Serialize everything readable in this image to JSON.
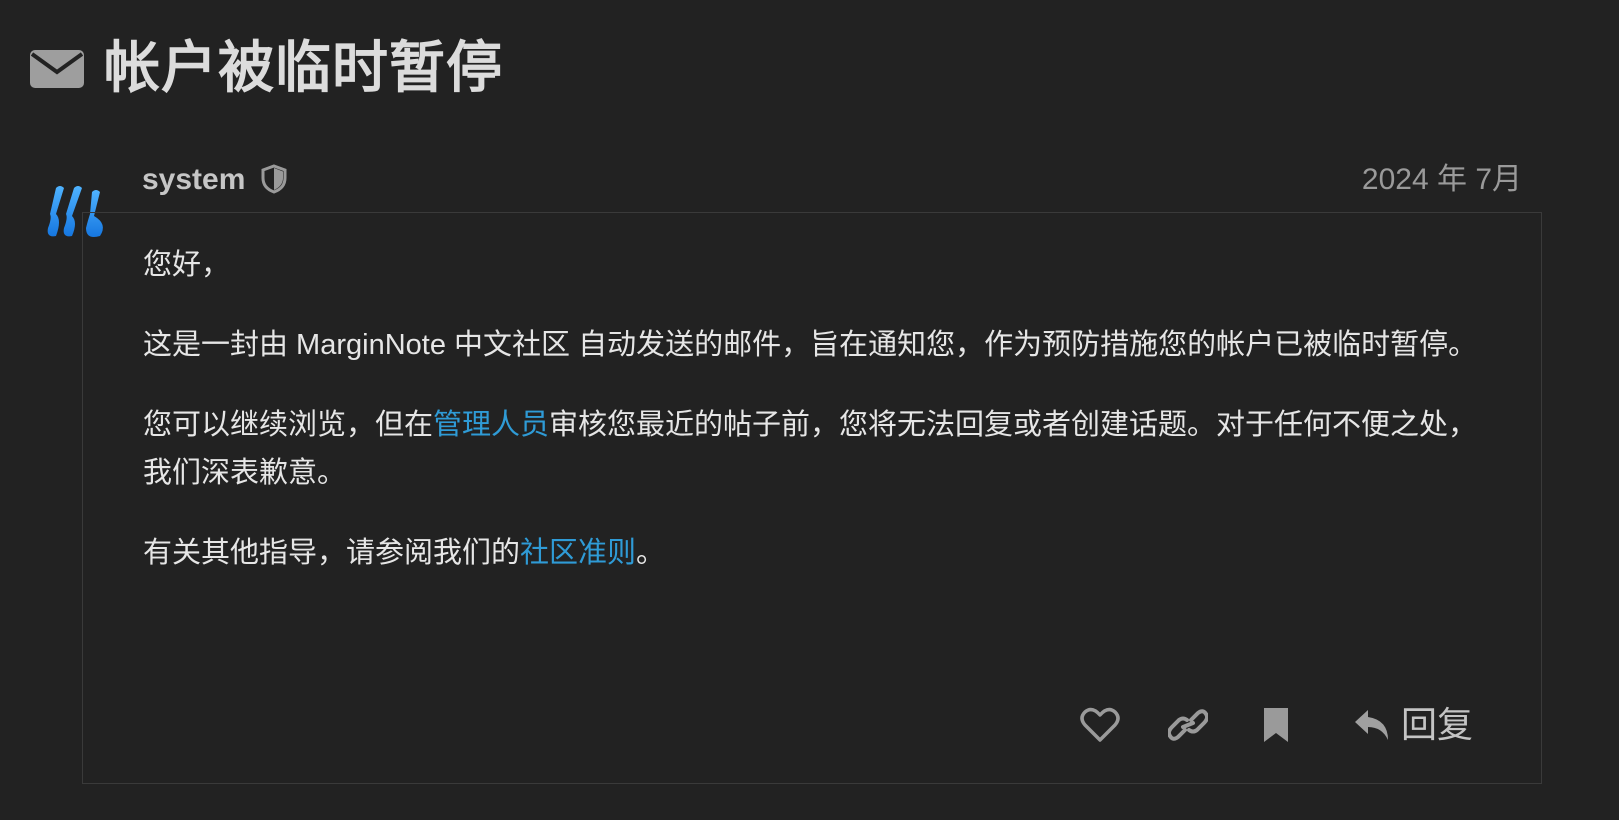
{
  "topic": {
    "title": "帐户被临时暂停",
    "icon": "envelope-icon"
  },
  "post": {
    "author": "system",
    "author_badge_icon": "shield-icon",
    "date": "2024 年 7月",
    "avatar_icon": "marginnote-logo",
    "paragraphs": {
      "p1": "您好，",
      "p2": "这是一封由 MarginNote 中文社区 自动发送的邮件，旨在通知您，作为预防措施您的帐户已被临时暂停。",
      "p3_before": "您可以继续浏览，但在",
      "p3_link": "管理人员",
      "p3_after": "审核您最近的帖子前，您将无法回复或者创建话题。对于任何不便之处，我们深表歉意。",
      "p4_before": "有关其他指导，请参阅我们的",
      "p4_link": "社区准则",
      "p4_after": "。"
    }
  },
  "controls": {
    "like_icon": "heart-icon",
    "share_icon": "link-icon",
    "bookmark_icon": "bookmark-icon",
    "reply_icon": "reply-icon",
    "reply_label": "回复"
  },
  "colors": {
    "background": "#222222",
    "link": "#2f9bd6",
    "logo_blue": "#1e8fe6"
  }
}
